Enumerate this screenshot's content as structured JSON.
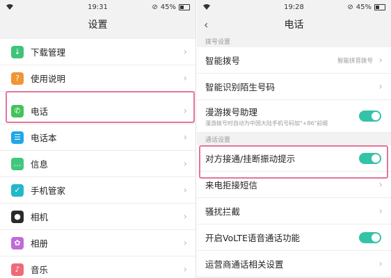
{
  "left": {
    "status": {
      "time": "19:31",
      "battery": "45%"
    },
    "title": "设置",
    "items": [
      {
        "label": "下载管理",
        "icon": "download-icon",
        "color": "#3ec37a"
      },
      {
        "label": "使用说明",
        "icon": "help-icon",
        "color": "#f19535"
      },
      {
        "label": "电话",
        "icon": "phone-icon",
        "color": "#43c35a"
      },
      {
        "label": "电话本",
        "icon": "contacts-icon",
        "color": "#1fa7e6"
      },
      {
        "label": "信息",
        "icon": "message-icon",
        "color": "#41c77d"
      },
      {
        "label": "手机管家",
        "icon": "shield-icon",
        "color": "#23b8c9"
      },
      {
        "label": "相机",
        "icon": "camera-icon",
        "color": "#2a2a2a"
      },
      {
        "label": "相册",
        "icon": "album-icon",
        "color": "#c06bd9"
      },
      {
        "label": "音乐",
        "icon": "music-icon",
        "color": "#f06a78"
      }
    ]
  },
  "right": {
    "status": {
      "time": "19:28",
      "battery": "45%"
    },
    "title": "电话",
    "sections": [
      {
        "header": "拨号设置",
        "items": [
          {
            "label": "智能拨号",
            "value": "智能拼音拨号"
          },
          {
            "label": "智能识别陌生号码"
          },
          {
            "label": "漫游拨号助理",
            "sub": "漫游拨号时自动为中国大陆手机号码加\"+86\"前缀",
            "toggle": "on"
          }
        ]
      },
      {
        "header": "通话设置",
        "items": [
          {
            "label": "对方接通/挂断振动提示",
            "toggle": "on"
          },
          {
            "label": "来电拒接短信"
          },
          {
            "label": "骚扰拦截"
          },
          {
            "label": "开启VoLTE语音通话功能",
            "toggle": "on"
          },
          {
            "label": "运营商通话相关设置"
          }
        ]
      }
    ]
  },
  "colors": {
    "accent_toggle": "#33c3a6",
    "highlight": "#e4749b"
  }
}
